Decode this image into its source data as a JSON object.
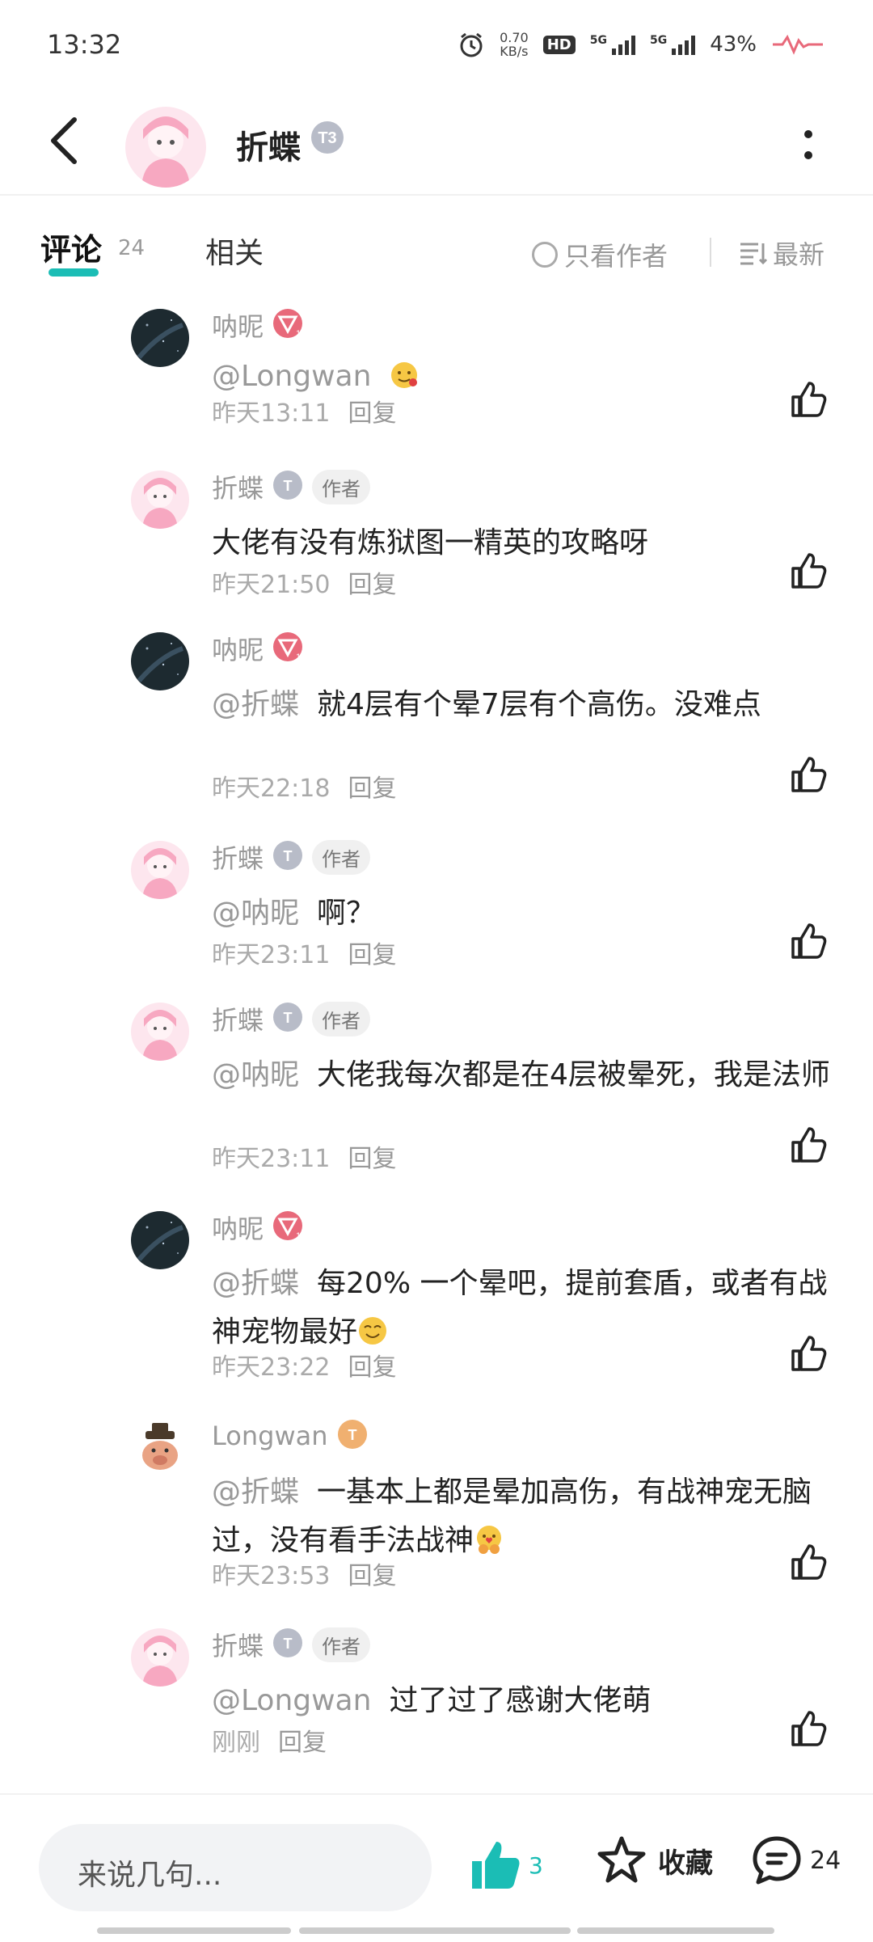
{
  "status_bar": {
    "time": "13:32",
    "net_speed_value": "0.70",
    "net_speed_unit": "KB/s",
    "hd": "HD",
    "sim1": "5G",
    "sim2": "5G",
    "battery": "43%"
  },
  "header": {
    "title": "折蝶",
    "badge": "T3"
  },
  "tabs": {
    "comments_label": "评论",
    "comments_count": "24",
    "related_label": "相关",
    "author_only_label": "只看作者",
    "sort_label": "最新"
  },
  "comments": [
    {
      "user": "呐昵",
      "badge": "T11",
      "is_author": false,
      "mention": "@Longwan",
      "text": "",
      "emoji": "face",
      "time": "昨天13:11",
      "reply": "回复"
    },
    {
      "user": "折蝶",
      "badge": "T3",
      "is_author": true,
      "author_tag": "作者",
      "mention": "",
      "text": "大佬有没有炼狱图一精英的攻略呀",
      "time": "昨天21:50",
      "reply": "回复"
    },
    {
      "user": "呐昵",
      "badge": "T11",
      "is_author": false,
      "mention": "@折蝶",
      "text": "就4层有个晕7层有个高伤。没难点",
      "time": "昨天22:18",
      "reply": "回复"
    },
    {
      "user": "折蝶",
      "badge": "T3",
      "is_author": true,
      "author_tag": "作者",
      "mention": "@呐昵",
      "text": "啊？",
      "time": "昨天23:11",
      "reply": "回复"
    },
    {
      "user": "折蝶",
      "badge": "T3",
      "is_author": true,
      "author_tag": "作者",
      "mention": "@呐昵",
      "text": "大佬我每次都是在4层被晕死，我是法师",
      "time": "昨天23:11",
      "reply": "回复"
    },
    {
      "user": "呐昵",
      "badge": "T11",
      "is_author": false,
      "mention": "@折蝶",
      "text": "每20% 一个晕吧，提前套盾，或者有战神宠物最好",
      "emoji": "smile",
      "time": "昨天23:22",
      "reply": "回复"
    },
    {
      "user": "Longwan",
      "badge": "T4",
      "is_author": false,
      "mention": "@折蝶",
      "text": "一基本上都是晕加高伤，有战神宠无脑过，没有看手法战神",
      "emoji": "hug",
      "time": "昨天23:53",
      "reply": "回复"
    },
    {
      "user": "折蝶",
      "badge": "T3",
      "is_author": true,
      "author_tag": "作者",
      "mention": "@Longwan",
      "text": "过了过了感谢大佬萌",
      "time": "刚刚",
      "reply": "回复"
    }
  ],
  "bottom_bar": {
    "input_placeholder": "来说几句...",
    "like_count": "3",
    "favorite_label": "收藏",
    "comment_count": "24"
  },
  "colors": {
    "accent": "#1bbdb5",
    "level_badge_pink": "#e8697a",
    "level_badge_gray": "#b8bcc8",
    "level_badge_gold": "#f0b070"
  }
}
